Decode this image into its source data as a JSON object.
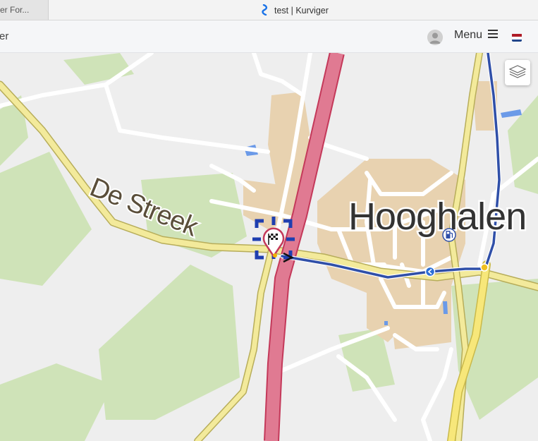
{
  "tabs": [
    {
      "label": "er For..."
    },
    {
      "label": "test | Kurviger"
    }
  ],
  "header": {
    "left_text": "er",
    "menu_label": "Menu"
  },
  "map": {
    "labels": {
      "street": "De Streek",
      "town": "Hooghalen"
    },
    "icons": [
      "layers-icon",
      "destination-flag-icon",
      "fuel-station-icon",
      "turn-left-icon"
    ]
  },
  "colors": {
    "route": "#2f4fa8",
    "highway": "#e07a92",
    "main_road": "#f3ea9b",
    "urban_area": "#e8d2b0",
    "forest": "#cfe3b8",
    "water": "#6b9ae8"
  }
}
